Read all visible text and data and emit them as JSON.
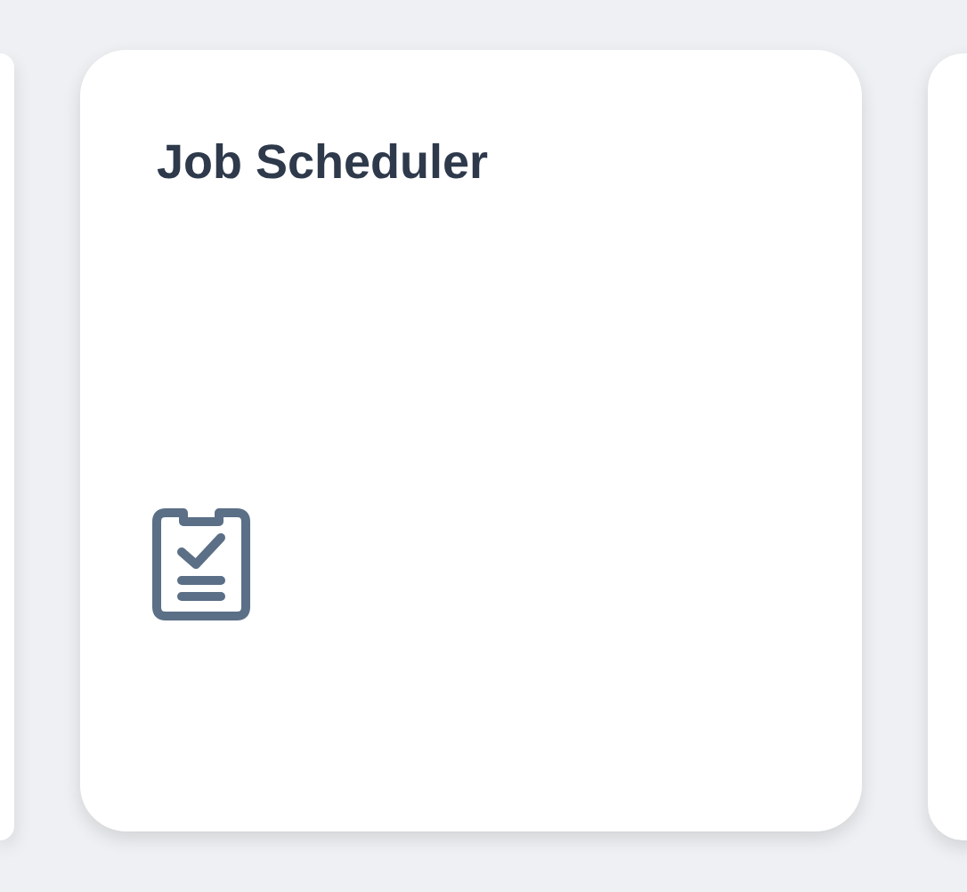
{
  "card": {
    "title": "Job Scheduler"
  }
}
